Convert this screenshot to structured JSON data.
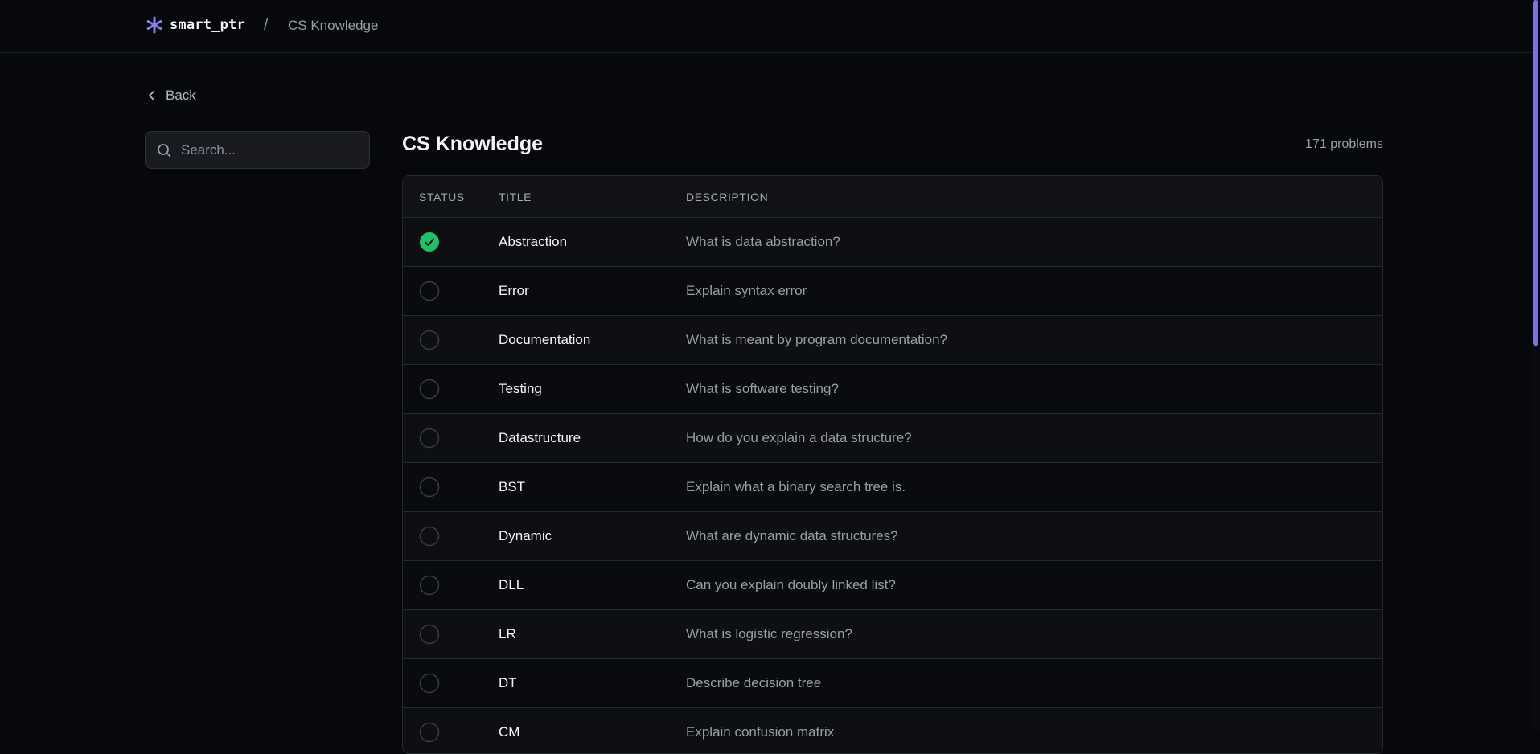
{
  "brand": {
    "name": "smart_ptr",
    "icon": "asterisk-icon",
    "accent": "#8b80f0"
  },
  "breadcrumb": {
    "separator": "/",
    "current": "CS Knowledge"
  },
  "back": {
    "label": "Back",
    "icon": "chevron-left-icon"
  },
  "search": {
    "placeholder": "Search...",
    "value": "",
    "icon": "search-icon"
  },
  "main": {
    "title": "CS Knowledge",
    "count": "171 problems"
  },
  "table": {
    "columns": [
      "STATUS",
      "TITLE",
      "DESCRIPTION"
    ],
    "rows": [
      {
        "status": "solved",
        "title": "Abstraction",
        "description": "What is data abstraction?"
      },
      {
        "status": "unsolved",
        "title": "Error",
        "description": "Explain syntax error"
      },
      {
        "status": "unsolved",
        "title": "Documentation",
        "description": "What is meant by program documentation?"
      },
      {
        "status": "unsolved",
        "title": "Testing",
        "description": "What is software testing?"
      },
      {
        "status": "unsolved",
        "title": "Datastructure",
        "description": "How do you explain a data structure?"
      },
      {
        "status": "unsolved",
        "title": "BST",
        "description": "Explain what a binary search tree is."
      },
      {
        "status": "unsolved",
        "title": "Dynamic",
        "description": "What are dynamic data structures?"
      },
      {
        "status": "unsolved",
        "title": "DLL",
        "description": "Can you explain doubly linked list?"
      },
      {
        "status": "unsolved",
        "title": "LR",
        "description": "What is logistic regression?"
      },
      {
        "status": "unsolved",
        "title": "DT",
        "description": "Describe decision tree"
      },
      {
        "status": "unsolved",
        "title": "CM",
        "description": "Explain confusion matrix"
      }
    ]
  },
  "colors": {
    "solved": "#1fc26b",
    "background": "#07080c",
    "scrollbar": "#7b72e0"
  }
}
